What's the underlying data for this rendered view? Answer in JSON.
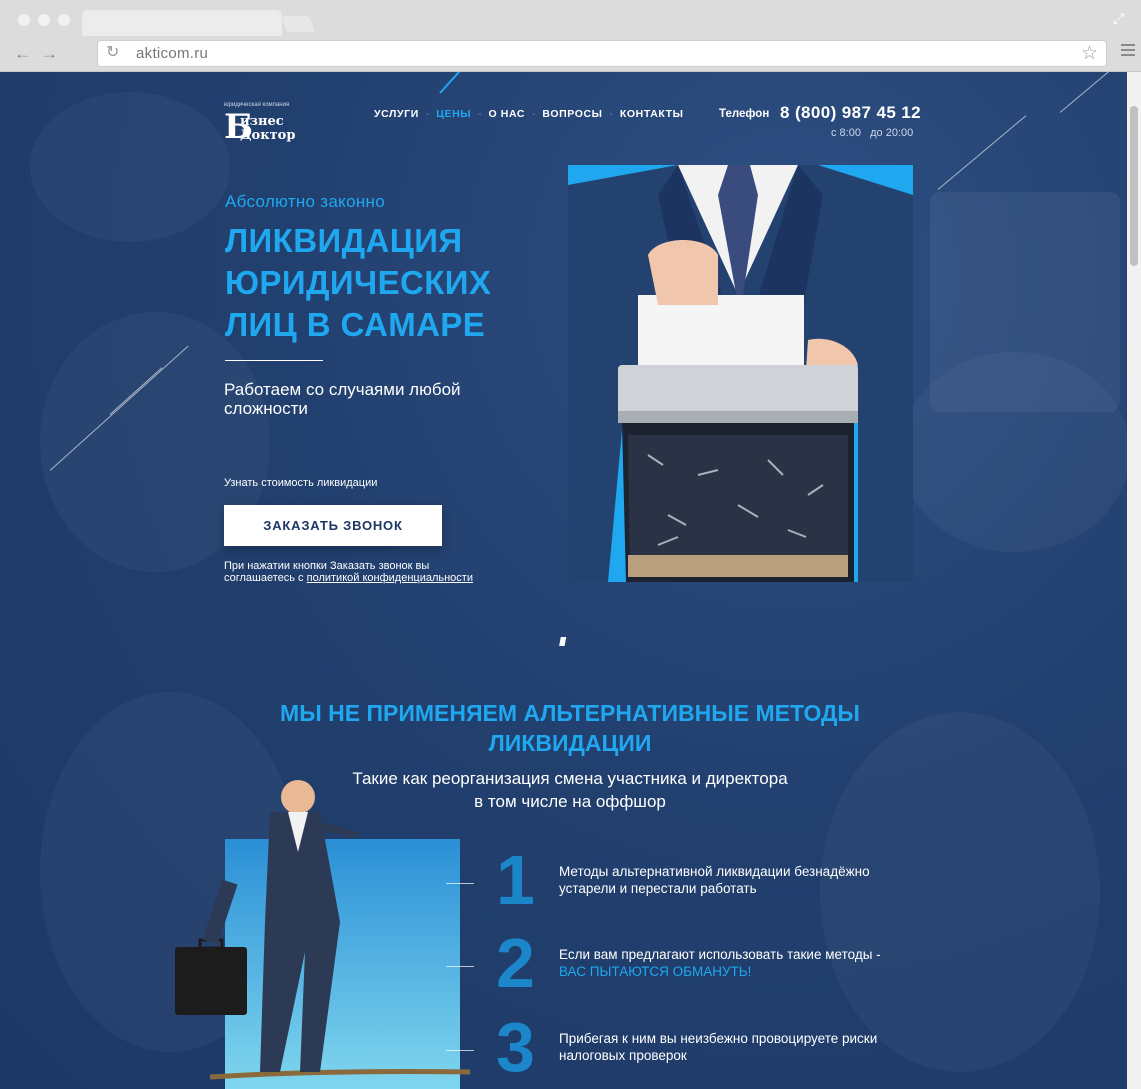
{
  "browser": {
    "url": "akticom.ru"
  },
  "header": {
    "logo": {
      "caption": "юридическая компания",
      "big_letter": "Б",
      "line1": "изнес",
      "line2": "Доктор"
    },
    "nav": [
      {
        "label": "УСЛУГИ",
        "active": false
      },
      {
        "label": "ЦЕНЫ",
        "active": true
      },
      {
        "label": "О НАС",
        "active": false
      },
      {
        "label": "ВОПРОСЫ",
        "active": false
      },
      {
        "label": "КОНТАКТЫ",
        "active": false
      }
    ],
    "phone_label": "Телефон",
    "phone": "8 (800) 987 45 12",
    "hours": "с 8:00   до 20:00"
  },
  "hero": {
    "eyebrow": "Абсолютно законно",
    "title": "ЛИКВИДАЦИЯ ЮРИДИЧЕСКИХ ЛИЦ В САМАРЕ",
    "subtitle": "Работаем со случаями любой сложности",
    "cost_label": "Узнать стоимость ликвидации",
    "cta": "ЗАКАЗАТЬ ЗВОНОК",
    "consent_text": "При нажатии кнопки Заказать звонок вы соглашаетесь с ",
    "consent_link": "политикой конфиденциальности"
  },
  "section2": {
    "title": "МЫ НЕ ПРИМЕНЯЕМ АЛЬТЕРНАТИВНЫЕ МЕТОДЫ ЛИКВИДАЦИИ",
    "subtitle_line1": "Такие как реорганизация смена участника и директора",
    "subtitle_line2": "в том числе на оффшор",
    "steps": [
      {
        "num": "1",
        "text": "Методы альтернативной ликвидации безнадёжно устарели и перестали работать",
        "highlight": ""
      },
      {
        "num": "2",
        "text": "Если вам предлагают использовать такие методы - ",
        "highlight": "ВАС ПЫТАЮТСЯ ОБМАНУТЬ!"
      },
      {
        "num": "3",
        "text": "Прибегая к ним вы неизбежно провоцируете риски налоговых проверок",
        "highlight": ""
      }
    ]
  },
  "colors": {
    "background": "#22406f",
    "accent": "#1fa8ef",
    "number": "#1b86c9",
    "white": "#ffffff"
  },
  "icons": [
    "back-icon",
    "forward-icon",
    "reload-icon",
    "star-icon",
    "menu-icon",
    "expand-icon",
    "scroll-down-icon"
  ]
}
